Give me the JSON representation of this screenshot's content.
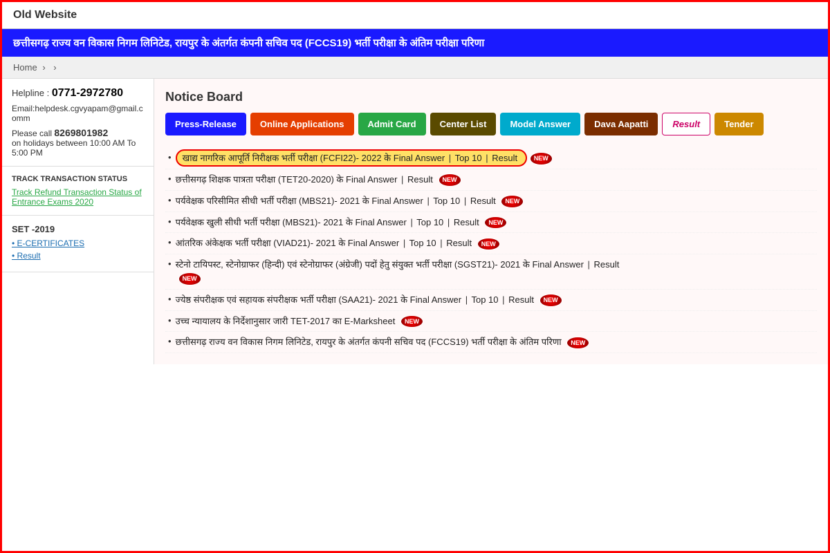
{
  "topBar": {
    "label": "Old Website"
  },
  "banner": {
    "text": "छत्तीसगढ़ राज्य  वन विकास निगम लिनिटेड, रायपुर के अंतर्गत कंपनी सचिव पद (FCCS19) भर्ती परीक्षा   के  अंतिम परीक्षा परिणा"
  },
  "breadcrumb": {
    "home": "Home",
    "sep1": "›",
    "sep2": "›"
  },
  "sidebar": {
    "helpline": {
      "label": "Helpline : ",
      "number": "0771-2972780",
      "email": "Email:helpdesk.cgvyapam@gmail.com",
      "email_suffix": "m",
      "call_prefix": "Please call",
      "call_number": "8269801982",
      "call_hours": "on holidays between 10:00 AM To 5:00 PM"
    },
    "track": {
      "label": "TRACK TRANSACTION STATUS",
      "link": "Track Refund Transaction Status of Entrance Exams 2020"
    },
    "set": {
      "label": "SET -2019",
      "links": [
        "E-CERTIFICATES",
        "Result"
      ]
    }
  },
  "noticeBoard": {
    "title": "Notice Board",
    "buttons": [
      {
        "label": "Press-Release",
        "class": "btn-press-release"
      },
      {
        "label": "Online Applications",
        "class": "btn-online-app"
      },
      {
        "label": "Admit Card",
        "class": "btn-admit-card"
      },
      {
        "label": "Center List",
        "class": "btn-center-list"
      },
      {
        "label": "Model Answer",
        "class": "btn-model-answer"
      },
      {
        "label": "Dava Aapatti",
        "class": "btn-dava-aapatti"
      },
      {
        "label": "Result",
        "class": "btn-result"
      },
      {
        "label": "Tender",
        "class": "btn-tender"
      }
    ],
    "notices": [
      {
        "id": 1,
        "text": "खाद्य नागरिक आपूर्ति निरीक्षक भर्ती परीक्षा (FCFI22)- 2022 के Final Answer | Top 10 | Result",
        "highlighted": true,
        "new": true
      },
      {
        "id": 2,
        "text": "छत्तीसगढ़ शिक्षक पात्रता परीक्षा (TET20-2020) के  Final Answer | Result",
        "highlighted": false,
        "new": true
      },
      {
        "id": 3,
        "text": "पर्यवेक्षक  परिसीमित सीधी भर्ती परीक्षा (MBS21)- 2021 के Final Answer | Top 10 | Result",
        "highlighted": false,
        "new": true
      },
      {
        "id": 4,
        "text": "पर्यवेक्षक खुली सीधी भर्ती परीक्षा  (MBS21)- 2021 के Final Answer | Top 10 | Result",
        "highlighted": false,
        "new": true
      },
      {
        "id": 5,
        "text": "आंतरिक अंकेक्षक भर्ती परीक्षा (VIAD21)- 2021 के Final Answer | Top 10 | Result",
        "highlighted": false,
        "new": true
      },
      {
        "id": 6,
        "text": "स्टेनो टायिपस्ट, स्टेनोग्राफर (हिन्दी) एवं स्टेनोग्राफर (अंग्रेजी) पदों हेतु संयुक्त भर्ती परीक्षा (SGST21)- 2021 के Final Answer | Result",
        "highlighted": false,
        "new": true
      },
      {
        "id": 7,
        "text": "ज्येष्ठ संपरीक्षक एवं सहायक संपरीक्षक भर्ती परीक्षा (SAA21)- 2021 के Final Answer | Top 10 | Result",
        "highlighted": false,
        "new": true
      },
      {
        "id": 8,
        "text": "उच्च न्यायालय के निर्देशानुसार जारी TET-2017 का E-Marksheet",
        "highlighted": false,
        "new": true
      },
      {
        "id": 9,
        "text": "छत्तीसगढ़ राज्य  वन विकास निगम लिनिटेड, रायपुर के अंतर्गत कंपनी सचिव पद (FCCS19) भर्ती परीक्षा  के  अंतिम परिणा",
        "highlighted": false,
        "new": true
      }
    ]
  }
}
